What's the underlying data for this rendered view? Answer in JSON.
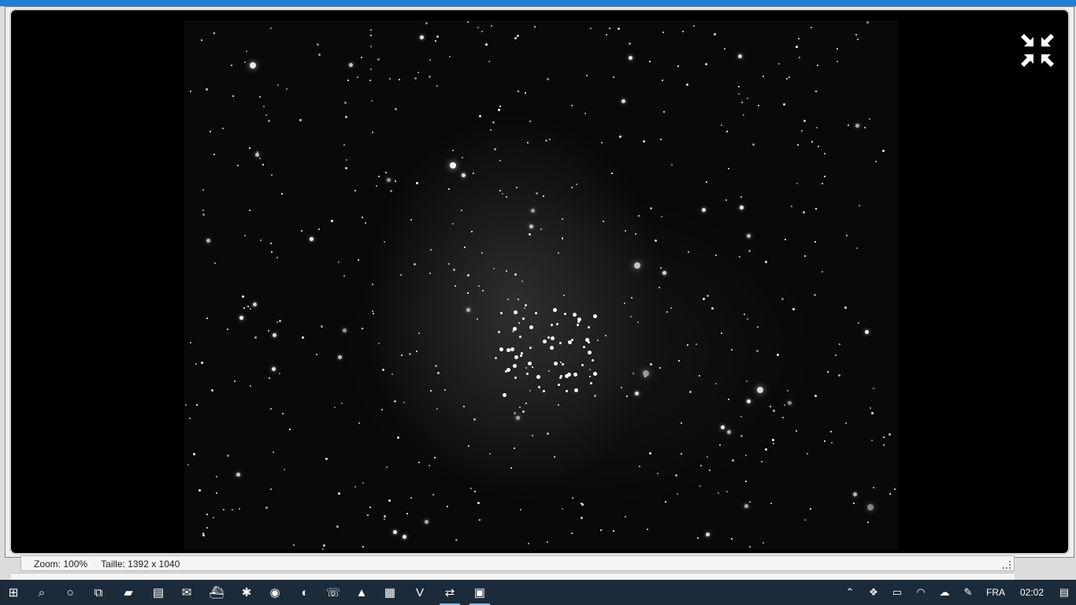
{
  "status_bar": {
    "zoom": "Zoom: 100%",
    "size": "Taille: 1392 x 1040"
  },
  "viewer": {
    "shrink_label": "Quitter le plein écran"
  },
  "taskbar": {
    "apps": [
      {
        "name": "windows-start",
        "glyph": "⊞",
        "active": false
      },
      {
        "name": "search",
        "glyph": "⌕",
        "active": false
      },
      {
        "name": "cortana",
        "glyph": "○",
        "active": false
      },
      {
        "name": "task-view",
        "glyph": "⧉",
        "active": false
      },
      {
        "name": "file-explorer",
        "glyph": "▰",
        "active": false
      },
      {
        "name": "store",
        "glyph": "▤",
        "active": false
      },
      {
        "name": "mail",
        "glyph": "✉",
        "active": false
      },
      {
        "name": "boat-app",
        "glyph": "⛴",
        "active": false
      },
      {
        "name": "bluetooth-app",
        "glyph": "✱",
        "active": false
      },
      {
        "name": "chrome",
        "glyph": "◉",
        "active": false
      },
      {
        "name": "bird-app",
        "glyph": "◐",
        "active": false
      },
      {
        "name": "whatsapp",
        "glyph": "☏",
        "active": false
      },
      {
        "name": "vlc",
        "glyph": "▲",
        "active": false
      },
      {
        "name": "notepad-app",
        "glyph": "▦",
        "active": false
      },
      {
        "name": "vivaldi",
        "glyph": "V",
        "active": false
      },
      {
        "name": "link-app",
        "glyph": "⇄",
        "active": true
      },
      {
        "name": "terminal-app",
        "glyph": "▣",
        "active": true
      }
    ],
    "lang": "FRA",
    "time": "02:02"
  },
  "colors": {
    "accent": "#1e7fd6",
    "taskbar": "#1c2b3a"
  }
}
